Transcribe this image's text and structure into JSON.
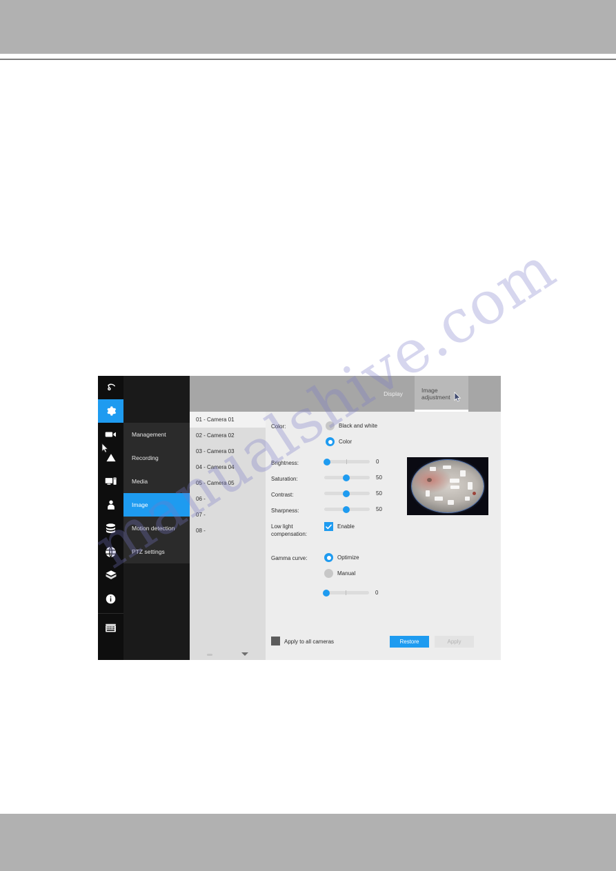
{
  "app": {
    "icon_rail": [
      {
        "name": "back-arrow-icon",
        "label": "Back"
      },
      {
        "name": "gear-icon",
        "label": "Settings",
        "active": true
      },
      {
        "name": "camera-icon",
        "label": "Camera"
      },
      {
        "name": "alarm-icon",
        "label": "Alarm"
      },
      {
        "name": "monitor-icon",
        "label": "Display"
      },
      {
        "name": "user-icon",
        "label": "User"
      },
      {
        "name": "storage-icon",
        "label": "Storage"
      },
      {
        "name": "network-icon",
        "label": "Network"
      },
      {
        "name": "system-icon",
        "label": "System"
      },
      {
        "name": "info-icon",
        "label": "Information"
      },
      {
        "name": "keyboard-icon",
        "label": "Keyboard"
      }
    ],
    "submenu": {
      "items": [
        {
          "label": "Management",
          "active": false
        },
        {
          "label": "Recording",
          "active": false
        },
        {
          "label": "Media",
          "active": false
        },
        {
          "label": "Image",
          "active": true
        },
        {
          "label": "Motion detection",
          "active": false
        },
        {
          "label": "PTZ settings",
          "active": false
        }
      ]
    },
    "tabs": [
      {
        "label": "Display",
        "active": false
      },
      {
        "label": "Image adjustment",
        "active": true
      }
    ],
    "camera_list": [
      {
        "label": "01 - Camera 01",
        "selected": true
      },
      {
        "label": "02 - Camera 02",
        "selected": false
      },
      {
        "label": "03 - Camera 03",
        "selected": false
      },
      {
        "label": "04 - Camera 04",
        "selected": false
      },
      {
        "label": "05 - Camera 05",
        "selected": false
      },
      {
        "label": "06 -",
        "selected": false
      },
      {
        "label": "07 -",
        "selected": false
      },
      {
        "label": "08 -",
        "selected": false
      }
    ],
    "settings": {
      "color": {
        "label": "Color:",
        "options": [
          {
            "label": "Black and white",
            "selected": false
          },
          {
            "label": "Color",
            "selected": true
          }
        ]
      },
      "brightness": {
        "label": "Brightness:",
        "value": "0",
        "percent": 3
      },
      "saturation": {
        "label": "Saturation:",
        "value": "50",
        "percent": 48
      },
      "contrast": {
        "label": "Contrast:",
        "value": "50",
        "percent": 48
      },
      "sharpness": {
        "label": "Sharpness:",
        "value": "50",
        "percent": 48
      },
      "low_light": {
        "label": "Low light\ncompensation:",
        "checkbox_label": "Enable",
        "checked": true
      },
      "gamma": {
        "label": "Gamma curve:",
        "options": [
          {
            "label": "Optimize",
            "selected": true
          },
          {
            "label": "Manual",
            "selected": false
          }
        ],
        "value": "0",
        "percent": 3
      },
      "apply_all": {
        "label": "Apply to all cameras",
        "checked": false
      },
      "restore_label": "Restore",
      "apply_label": "Apply"
    },
    "preview": {
      "name": "camera-preview-thumbnail"
    }
  },
  "watermark": {
    "text": "manualshive.com"
  },
  "colors": {
    "accent": "#1e9bf0",
    "rail_bg": "#0e0e0e",
    "submenu_bg": "#2b2b2b",
    "tabbar_bg": "#a6a6a6",
    "panel_bg": "#ededed",
    "list_bg": "#dcdcdc",
    "page_band": "#b1b1b1"
  }
}
